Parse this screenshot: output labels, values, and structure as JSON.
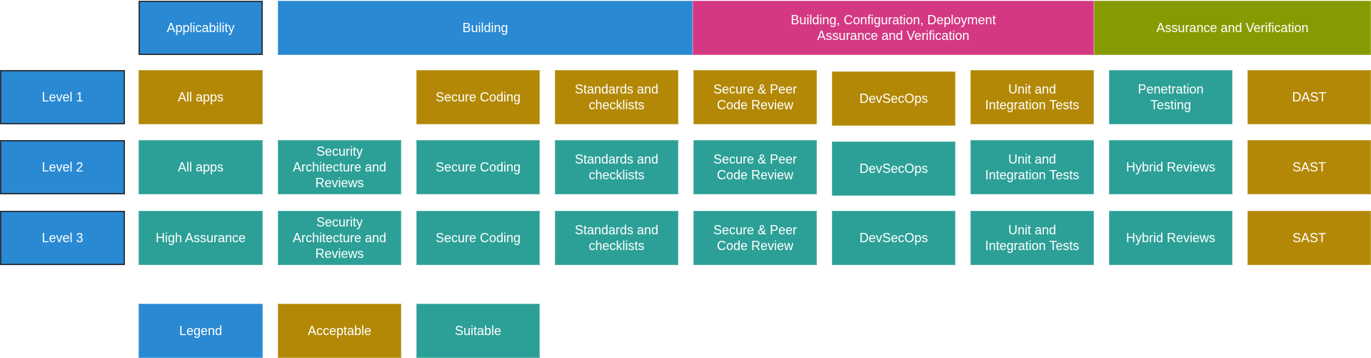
{
  "colors": {
    "header_blue": "#2a89d3",
    "acceptable": "#b38806",
    "suitable": "#2ca097",
    "phase_pink": "#d43883",
    "phase_olive": "#889a02"
  },
  "header": {
    "applicability": "Applicability",
    "phases": [
      {
        "label": "Building"
      },
      {
        "label": "Building, Configuration, Deployment\nAssurance and Verification"
      },
      {
        "label": "Assurance and Verification"
      }
    ]
  },
  "levels": [
    {
      "label": "Level 1",
      "cells": [
        {
          "text": "All apps",
          "status": "Acceptable"
        },
        {
          "text": "",
          "status": "none"
        },
        {
          "text": "Secure Coding",
          "status": "Acceptable"
        },
        {
          "text": "Standards and\nchecklists",
          "status": "Acceptable"
        },
        {
          "text": "Secure & Peer\nCode Review",
          "status": "Acceptable"
        },
        {
          "text": "DevSecOps",
          "status": "Acceptable"
        },
        {
          "text": "Unit and\nIntegration Tests",
          "status": "Acceptable"
        },
        {
          "text": "Penetration\nTesting",
          "status": "Suitable"
        },
        {
          "text": "DAST",
          "status": "Acceptable"
        }
      ]
    },
    {
      "label": "Level 2",
      "cells": [
        {
          "text": "All apps",
          "status": "Suitable"
        },
        {
          "text": "Security\nArchitecture and\nReviews",
          "status": "Suitable"
        },
        {
          "text": "Secure Coding",
          "status": "Suitable"
        },
        {
          "text": "Standards and\nchecklists",
          "status": "Suitable"
        },
        {
          "text": "Secure & Peer\nCode Review",
          "status": "Suitable"
        },
        {
          "text": "DevSecOps",
          "status": "Suitable"
        },
        {
          "text": "Unit and\nIntegration Tests",
          "status": "Suitable"
        },
        {
          "text": "Hybrid Reviews",
          "status": "Suitable"
        },
        {
          "text": "SAST",
          "status": "Acceptable"
        }
      ]
    },
    {
      "label": "Level 3",
      "cells": [
        {
          "text": "High Assurance",
          "status": "Suitable"
        },
        {
          "text": "Security\nArchitecture and\nReviews",
          "status": "Suitable"
        },
        {
          "text": "Secure Coding",
          "status": "Suitable"
        },
        {
          "text": "Standards and\nchecklists",
          "status": "Suitable"
        },
        {
          "text": "Secure & Peer\nCode Review",
          "status": "Suitable"
        },
        {
          "text": "DevSecOps",
          "status": "Suitable"
        },
        {
          "text": "Unit and\nIntegration Tests",
          "status": "Suitable"
        },
        {
          "text": "Hybrid Reviews",
          "status": "Suitable"
        },
        {
          "text": "SAST",
          "status": "Acceptable"
        }
      ]
    }
  ],
  "legend": {
    "title": "Legend",
    "items": [
      {
        "label": "Acceptable"
      },
      {
        "label": "Suitable"
      }
    ]
  }
}
